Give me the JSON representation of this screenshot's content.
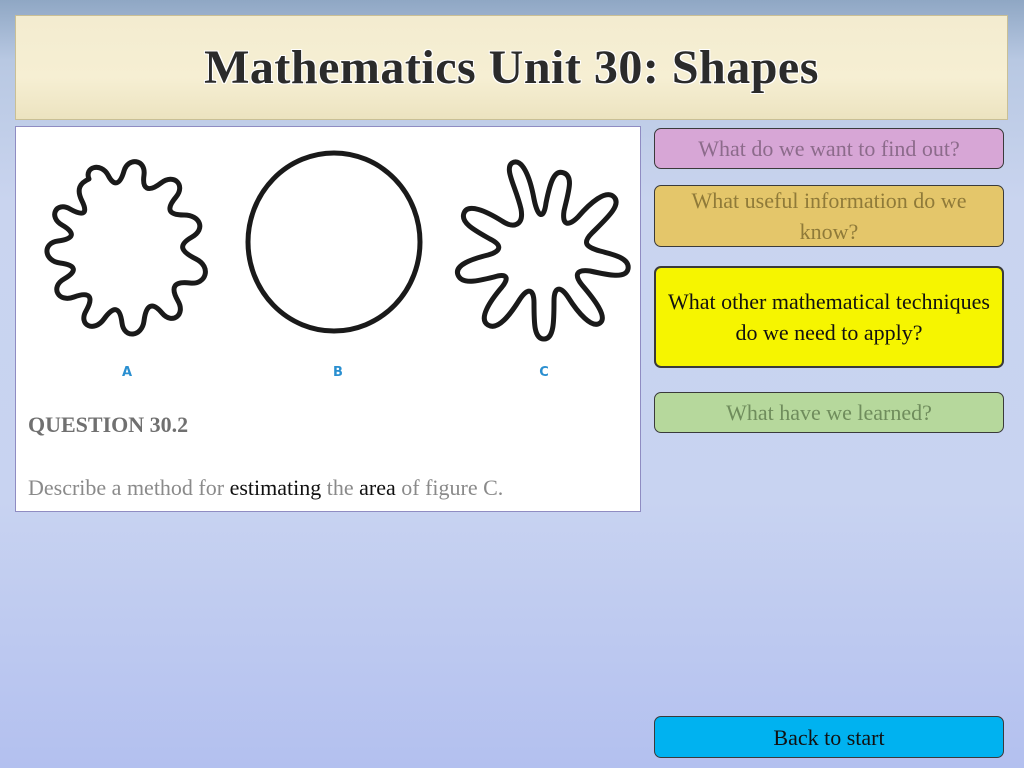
{
  "header": {
    "title": "Mathematics Unit 30: Shapes"
  },
  "question": {
    "figure_labels": [
      "A",
      "B",
      "C"
    ],
    "title": "QUESTION 30.2",
    "text_before": "Describe a method for ",
    "keyword1": "estimating",
    "text_mid": " the ",
    "keyword2": "area",
    "text_after": " of figure C."
  },
  "buttons": {
    "find_out": "What do we want to find out?",
    "useful_info": "What useful information do we know?",
    "techniques": "What other mathematical techniques do we need to apply?",
    "learned": "What have we learned?",
    "back": "Back to start"
  },
  "colors": {
    "find_out": "#d7a6d6",
    "useful_info": "#e4c66a",
    "techniques": "#f6f500",
    "learned": "#b6d89c",
    "back": "#00b2f0"
  }
}
